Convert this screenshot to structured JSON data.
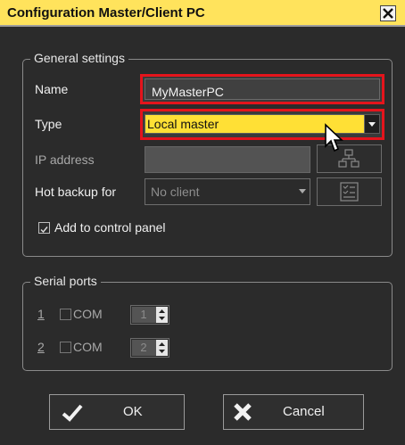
{
  "window": {
    "title": "Configuration Master/Client PC",
    "close_icon": "close-icon"
  },
  "general": {
    "legend": "General settings",
    "name_label": "Name",
    "name_value": "MyMasterPC",
    "type_label": "Type",
    "type_value": "Local master",
    "ip_label": "IP address",
    "ip_value": "",
    "network_icon": "network-tree-icon",
    "hot_backup_label": "Hot backup for",
    "hot_backup_value": "No client",
    "backup_icon": "checklist-icon",
    "add_to_panel_label": "Add to control panel",
    "add_to_panel_checked": true
  },
  "serial": {
    "legend": "Serial ports",
    "ports": [
      {
        "index": "1",
        "com_label": "COM",
        "checked": false,
        "number": "1"
      },
      {
        "index": "2",
        "com_label": "COM",
        "checked": false,
        "number": "2"
      }
    ]
  },
  "buttons": {
    "ok_label": "OK",
    "cancel_label": "Cancel"
  },
  "colors": {
    "title_bar": "#ffe35c",
    "highlight_border": "#e4141c",
    "type_field": "#ffe035"
  }
}
